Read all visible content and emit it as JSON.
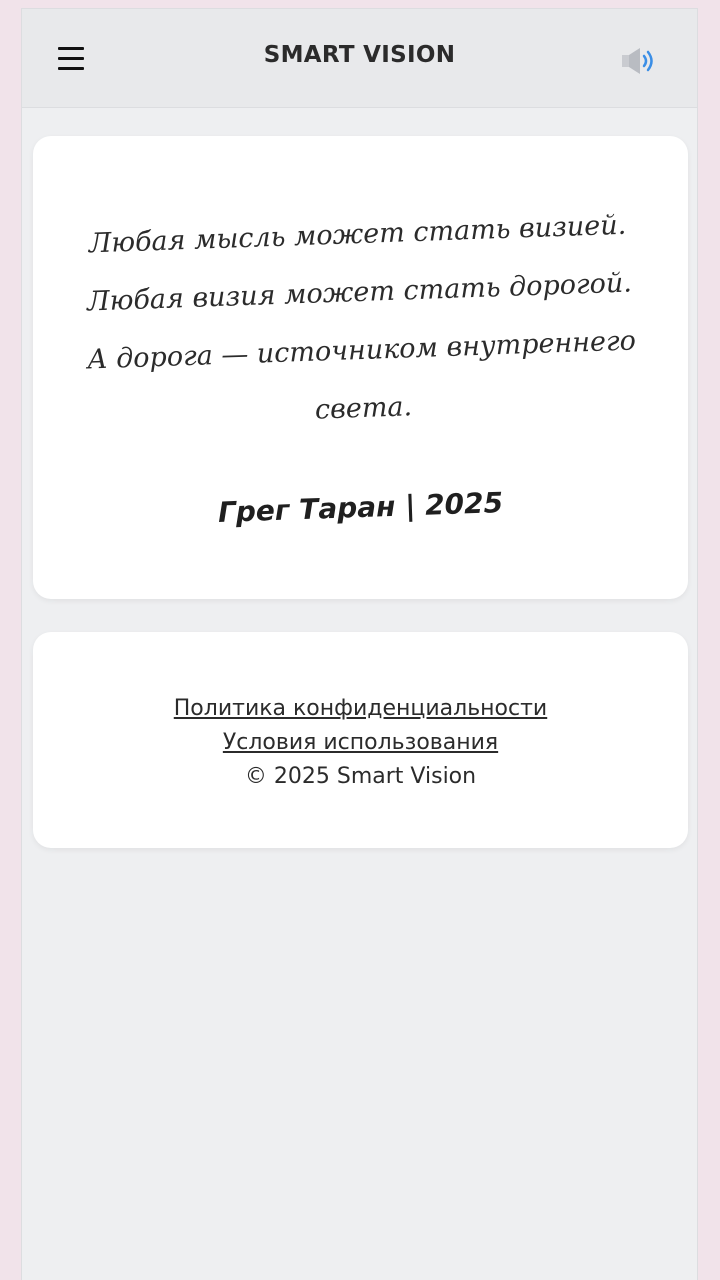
{
  "header": {
    "title": "SMART VISION",
    "menu_icon": "hamburger-menu-icon",
    "sound_icon": "speaker-icon"
  },
  "quote": {
    "lines": [
      "Любая мысль может стать визией.",
      "Любая визия может стать дорогой.",
      "А дорога — источником внутреннего",
      "света."
    ],
    "author": "Грег Таран | 2025"
  },
  "footer": {
    "privacy_link": "Политика конфиденциальности",
    "terms_link": "Условия использования",
    "copyright": "© 2025 Smart Vision"
  },
  "colors": {
    "page_background": "#f1e3ea",
    "app_background": "#eeeff1",
    "header_background": "#e8e9eb",
    "card_background": "#ffffff",
    "speaker_accent": "#3a8ee6"
  }
}
